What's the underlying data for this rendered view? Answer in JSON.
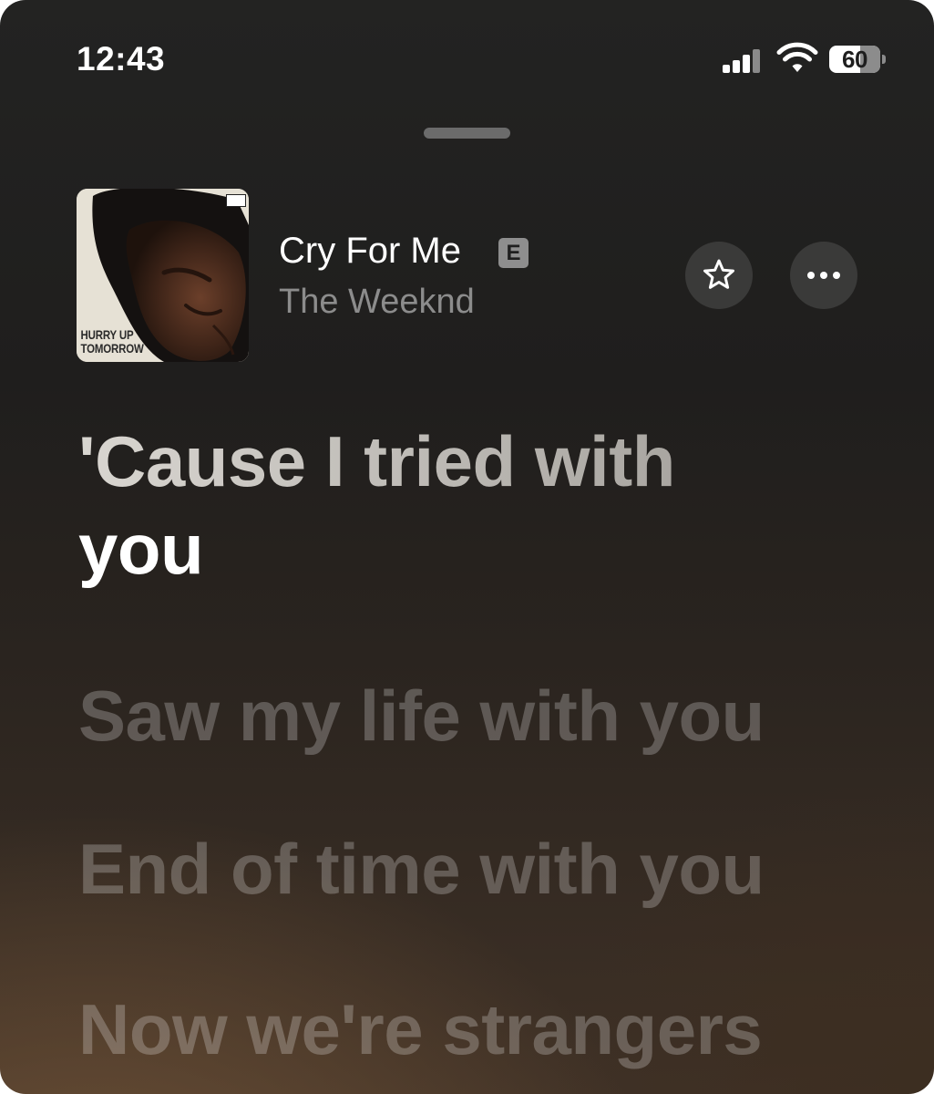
{
  "status_bar": {
    "time": "12:43",
    "battery_level": "60",
    "icons": [
      "cellular-signal-icon",
      "wifi-icon",
      "battery-icon"
    ]
  },
  "now_playing": {
    "album_art_title": "HURRY UP\nTOMORROW",
    "title": "Cry For Me",
    "explicit_badge": "E",
    "artist": "The Weeknd",
    "actions": [
      "star-icon",
      "ellipsis-icon"
    ]
  },
  "lyrics": {
    "current_sung": "'Cause I tried with",
    "current_active": "you",
    "upcoming": [
      "Saw my life with you",
      "End of time with you",
      "Now we're strangers"
    ]
  },
  "colors": {
    "background_top": "#232322",
    "background_bottom": "#3f3126",
    "lyric_active": "#ffffff",
    "lyric_upcoming": "rgba(255,255,255,0.24)",
    "artist_text": "#8c8c8c",
    "button_fill": "#3a3a39"
  }
}
